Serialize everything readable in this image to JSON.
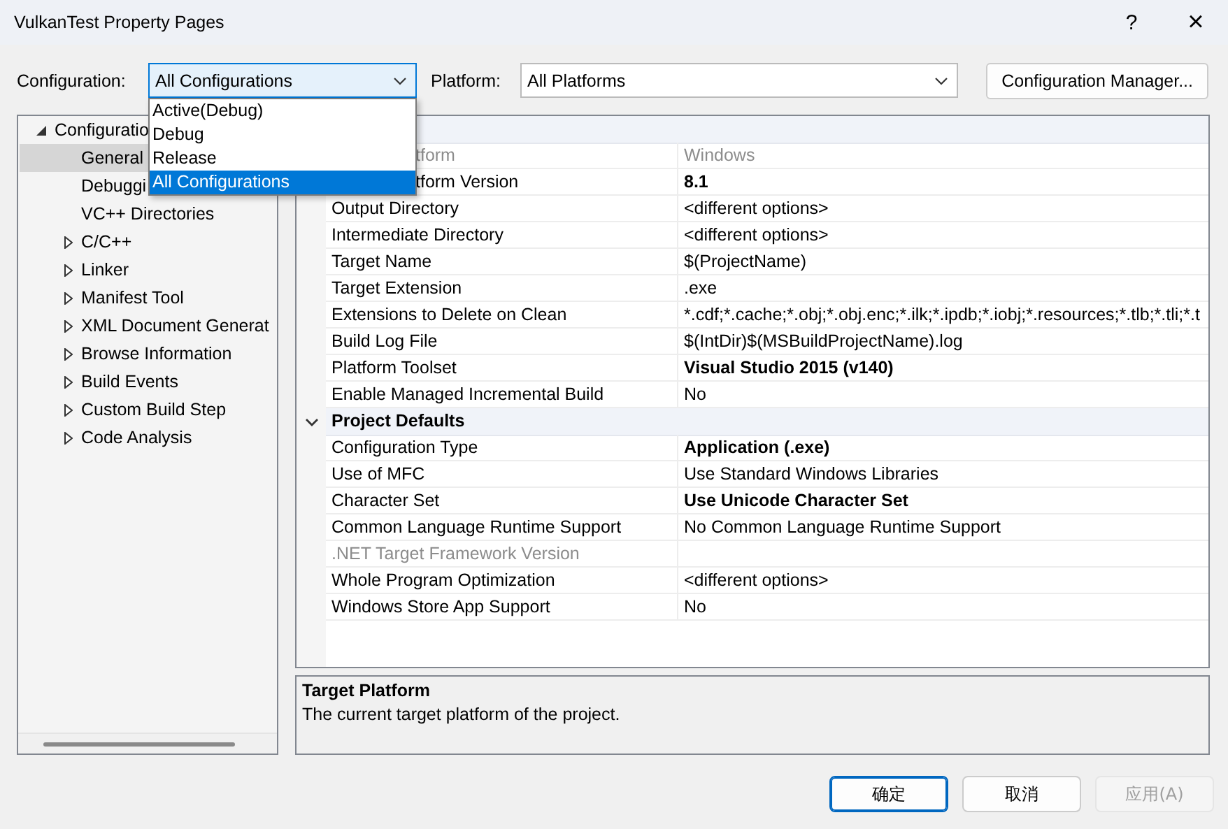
{
  "window": {
    "title": "VulkanTest Property Pages",
    "help_button": "?",
    "close_button": "×"
  },
  "configuration": {
    "label": "Configuration:",
    "value": "All Configurations",
    "options": [
      {
        "label": "Active(Debug)",
        "selected": false
      },
      {
        "label": "Debug",
        "selected": false
      },
      {
        "label": "Release",
        "selected": false
      },
      {
        "label": "All Configurations",
        "selected": true
      }
    ]
  },
  "platform": {
    "label": "Platform:",
    "value": "All Platforms"
  },
  "configuration_manager_button": "Configuration Manager...",
  "tree": [
    {
      "label": "Configuratio",
      "expanded": true,
      "selected": false,
      "children": [
        {
          "label": "General",
          "selected": true
        },
        {
          "label": "Debuggi",
          "selected": false
        },
        {
          "label": "VC++ Directories",
          "selected": false
        },
        {
          "label": "C/C++",
          "expanded": false,
          "selected": false
        },
        {
          "label": "Linker",
          "expanded": false,
          "selected": false
        },
        {
          "label": "Manifest Tool",
          "expanded": false,
          "selected": false
        },
        {
          "label": "XML Document Generat",
          "expanded": false,
          "selected": false
        },
        {
          "label": "Browse Information",
          "expanded": false,
          "selected": false
        },
        {
          "label": "Build Events",
          "expanded": false,
          "selected": false
        },
        {
          "label": "Custom Build Step",
          "expanded": false,
          "selected": false
        },
        {
          "label": "Code Analysis",
          "expanded": false,
          "selected": false
        }
      ]
    }
  ],
  "property_grid": {
    "sections": [
      {
        "rows": [
          {
            "name": "tform",
            "value": "Windows",
            "bold": false,
            "disabled": true
          },
          {
            "name": "tform Version",
            "value": "8.1",
            "bold": true,
            "disabled": false
          },
          {
            "name": "Output Directory",
            "value": "<different options>",
            "bold": false,
            "disabled": false
          },
          {
            "name": "Intermediate Directory",
            "value": "<different options>",
            "bold": false,
            "disabled": false
          },
          {
            "name": "Target Name",
            "value": "$(ProjectName)",
            "bold": false,
            "disabled": false
          },
          {
            "name": "Target Extension",
            "value": ".exe",
            "bold": false,
            "disabled": false
          },
          {
            "name": "Extensions to Delete on Clean",
            "value": "*.cdf;*.cache;*.obj;*.obj.enc;*.ilk;*.ipdb;*.iobj;*.resources;*.tlb;*.tli;*.t",
            "bold": false,
            "disabled": false
          },
          {
            "name": "Build Log File",
            "value": "$(IntDir)$(MSBuildProjectName).log",
            "bold": false,
            "disabled": false
          },
          {
            "name": "Platform Toolset",
            "value": "Visual Studio 2015 (v140)",
            "bold": true,
            "disabled": false
          },
          {
            "name": "Enable Managed Incremental Build",
            "value": "No",
            "bold": false,
            "disabled": false
          }
        ]
      },
      {
        "title": "Project Defaults",
        "expanded": true,
        "rows": [
          {
            "name": "Configuration Type",
            "value": "Application (.exe)",
            "bold": true,
            "disabled": false
          },
          {
            "name": "Use of MFC",
            "value": "Use Standard Windows Libraries",
            "bold": false,
            "disabled": false
          },
          {
            "name": "Character Set",
            "value": "Use Unicode Character Set",
            "bold": true,
            "disabled": false
          },
          {
            "name": "Common Language Runtime Support",
            "value": "No Common Language Runtime Support",
            "bold": false,
            "disabled": false
          },
          {
            "name": ".NET Target Framework Version",
            "bold": false,
            "disabled": true
          },
          {
            "name": "Whole Program Optimization",
            "value": "<different options>",
            "bold": false,
            "disabled": false
          },
          {
            "name": "Windows Store App Support",
            "value": "No",
            "bold": false,
            "disabled": false
          }
        ]
      }
    ]
  },
  "description": {
    "title": "Target Platform",
    "text": "The current target platform of the project."
  },
  "buttons": [
    {
      "label": "确定",
      "default": true,
      "disabled": false
    },
    {
      "label": "取消",
      "default": false,
      "disabled": false
    },
    {
      "label": "应用(A)",
      "default": false,
      "disabled": true
    }
  ]
}
